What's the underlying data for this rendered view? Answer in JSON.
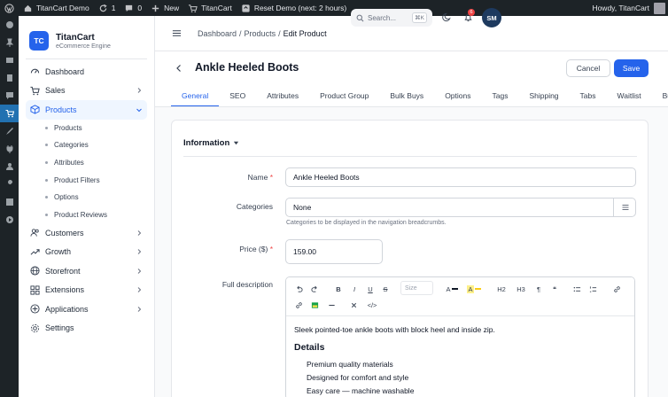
{
  "adminbar": {
    "site_name": "TitanCart Demo",
    "updates_count": "1",
    "comments_count": "0",
    "new_label": "New",
    "titancart_label": "TitanCart",
    "reset_label": "Reset Demo (next: 2 hours)",
    "howdy": "Howdy, TitanCart"
  },
  "brand": {
    "logo": "TC",
    "name": "TitanCart",
    "subtitle": "eCommerce Engine"
  },
  "sidebar": {
    "items": [
      {
        "label": "Dashboard",
        "icon": "dashboard-icon"
      },
      {
        "label": "Sales",
        "icon": "cart-icon"
      },
      {
        "label": "Products",
        "icon": "box-icon"
      },
      {
        "label": "Customers",
        "icon": "users-icon"
      },
      {
        "label": "Growth",
        "icon": "trend-icon"
      },
      {
        "label": "Storefront",
        "icon": "globe-icon"
      },
      {
        "label": "Extensions",
        "icon": "grid-icon"
      },
      {
        "label": "Applications",
        "icon": "apps-icon"
      },
      {
        "label": "Settings",
        "icon": "gear-icon"
      }
    ],
    "products_sub": [
      "Products",
      "Categories",
      "Attributes",
      "Product Filters",
      "Options",
      "Product Reviews"
    ]
  },
  "header": {
    "breadcrumb": [
      "Dashboard",
      "Products",
      "Edit Product"
    ],
    "search_placeholder": "Search...",
    "search_shortcut": "⌘K",
    "notification_count": "6",
    "avatar_initials": "SM"
  },
  "page": {
    "title": "Ankle Heeled Boots",
    "cancel_label": "Cancel",
    "save_label": "Save"
  },
  "tabs": [
    "General",
    "SEO",
    "Attributes",
    "Product Group",
    "Bulk Buys",
    "Options",
    "Tags",
    "Shipping",
    "Tabs",
    "Waitlist",
    "Bundle"
  ],
  "active_tab": "General",
  "form": {
    "section_title": "Information",
    "name_label": "Name",
    "name_value": "Ankle Heeled Boots",
    "categories_label": "Categories",
    "categories_value": "None",
    "categories_hint": "Categories to be displayed in the navigation breadcrumbs.",
    "price_label": "Price ($)",
    "price_value": "159.00",
    "description_label": "Full description",
    "required_mark": "*"
  },
  "editor": {
    "size_placeholder": "Size",
    "h2": "H2",
    "h3": "H3",
    "paragraph": "¶",
    "quote": "❝",
    "code": "</>",
    "text_color_label": "A",
    "highlight_label": "A",
    "content": {
      "intro": "Sleek pointed-toe ankle boots with block heel and inside zip.",
      "heading": "Details",
      "bullets": [
        "Premium quality materials",
        "Designed for comfort and style",
        "Easy care — machine washable"
      ]
    }
  },
  "colors": {
    "accent": "#2563eb",
    "admin_bar": "#1d2327",
    "danger": "#ef4444"
  }
}
